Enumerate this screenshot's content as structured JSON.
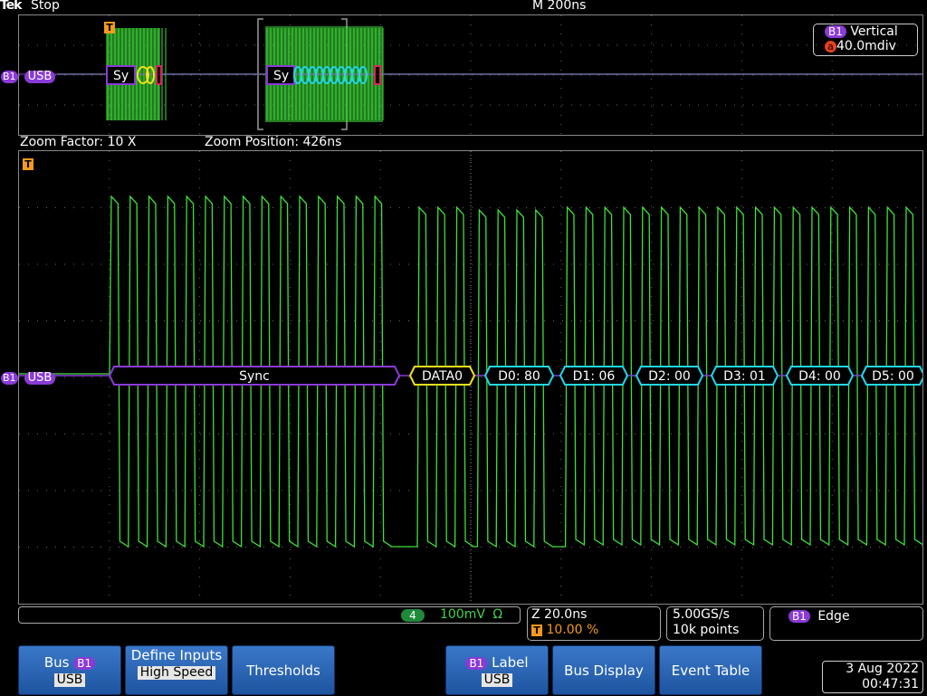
{
  "topbar": {
    "logo": "Tek",
    "acq_state": "Stop",
    "time_scale": "M 200ns"
  },
  "overview": {
    "bus_label": "USB",
    "bus_id": "B1",
    "trigger_marker": "T",
    "packet_labels": [
      "Sy",
      "Sy"
    ],
    "vertical_readout": {
      "title": "Vertical",
      "channel": "a",
      "value": "40.0mdiv"
    }
  },
  "zoom": {
    "factor": "Zoom Factor: 10 X",
    "position": "Zoom Position: 426ns"
  },
  "main": {
    "bus_label": "USB",
    "bus_id": "B1",
    "trigger_marker": "T",
    "packets": [
      {
        "label": "Sync",
        "kind": "sync"
      },
      {
        "label": "DATA0",
        "kind": "pid"
      },
      {
        "label": "D0: 80",
        "kind": "data"
      },
      {
        "label": "D1: 06",
        "kind": "data"
      },
      {
        "label": "D2: 00",
        "kind": "data"
      },
      {
        "label": "D3: 01",
        "kind": "data"
      },
      {
        "label": "D4: 00",
        "kind": "data"
      },
      {
        "label": "D5: 00",
        "kind": "data"
      }
    ]
  },
  "readouts": {
    "channel": {
      "number": "4",
      "scale": "100mV",
      "coupling": "Ω"
    },
    "zoom": {
      "label": "Z 20.0ns",
      "trigger_flag": "T",
      "position": "10.00 %"
    },
    "sample": {
      "rate": "5.00GS/s",
      "length": "10k points"
    },
    "trigger": {
      "source": "B1",
      "type": "Edge"
    }
  },
  "buttons": [
    {
      "id": "bus",
      "label": "Bus",
      "badge": "B1",
      "sub": "USB"
    },
    {
      "id": "define-inputs",
      "label": "Define Inputs",
      "sub": "High Speed"
    },
    {
      "id": "thresholds",
      "label": "Thresholds"
    },
    {
      "id": "label",
      "badge": "B1",
      "label": "Label",
      "sub": "USB"
    },
    {
      "id": "bus-display",
      "label": "Bus Display"
    },
    {
      "id": "event-table",
      "label": "Event Table"
    }
  ],
  "datetime": {
    "date": "3 Aug 2022",
    "time": "00:47:31"
  },
  "colors": {
    "trace": "#3fe03a",
    "bus_violet": "#8a3ad8",
    "pid_yellow": "#f2e21c",
    "data_cyan": "#20d8e8",
    "trigger_orange": "#f59a1c",
    "button_blue": "#2a64b4"
  }
}
